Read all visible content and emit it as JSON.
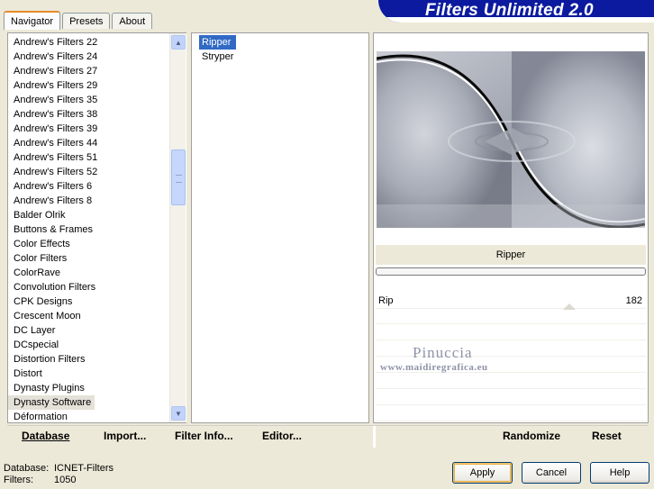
{
  "tabs": [
    {
      "label": "Navigator",
      "active": true
    },
    {
      "label": "Presets",
      "active": false
    },
    {
      "label": "About",
      "active": false
    }
  ],
  "brand": {
    "title": "Filters Unlimited 2.0"
  },
  "categories": {
    "items": [
      "Andrew's Filters 22",
      "Andrew's Filters 24",
      "Andrew's Filters 27",
      "Andrew's Filters 29",
      "Andrew's Filters 35",
      "Andrew's Filters 38",
      "Andrew's Filters 39",
      "Andrew's Filters 44",
      "Andrew's Filters 51",
      "Andrew's Filters 52",
      "Andrew's Filters 6",
      "Andrew's Filters 8",
      "Balder Olrik",
      "Buttons & Frames",
      "Color Effects",
      "Color Filters",
      "ColorRave",
      "Convolution Filters",
      "CPK Designs",
      "Crescent Moon",
      "DC Layer",
      "DCspecial",
      "Distortion Filters",
      "Distort",
      "Dynasty Plugins",
      "Dynasty Software",
      "Déformation"
    ],
    "selected": "Dynasty Software",
    "scroll_position": 0.33
  },
  "filters": {
    "items": [
      "Ripper",
      "Stryper"
    ],
    "selected": "Ripper"
  },
  "preview": {
    "filter_name": "Ripper",
    "progress": 0,
    "params": [
      {
        "name": "Rip",
        "value": "182"
      }
    ],
    "watermark_name": "Pinuccia",
    "watermark_url": "www.maidiregrafica.eu"
  },
  "toolbar": {
    "database": "Database",
    "import": "Import...",
    "filter_info": "Filter Info...",
    "editor": "Editor...",
    "randomize": "Randomize",
    "reset": "Reset"
  },
  "status": {
    "database_label": "Database:",
    "database_value": "ICNET-Filters",
    "filters_label": "Filters:",
    "filters_value": "1050"
  },
  "buttons": {
    "apply": "Apply",
    "cancel": "Cancel",
    "help": "Help"
  },
  "colors": {
    "brand_blue": "#0b1a9e",
    "selection_blue": "#316ac5",
    "dialog_bg": "#ece9d8"
  }
}
